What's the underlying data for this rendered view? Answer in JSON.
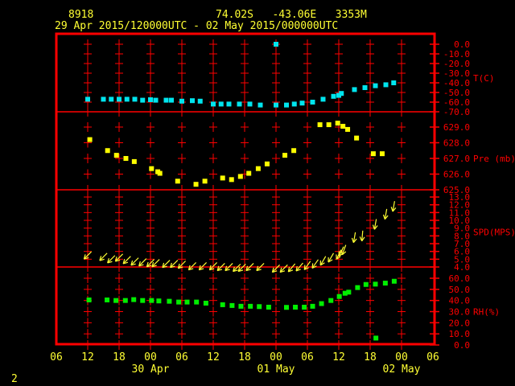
{
  "header": {
    "station_id": "8918",
    "location": "74.02S   -43.06E   3353M",
    "period": "29 Apr 2015/120000UTC - 02 May 2015/000000UTC"
  },
  "footer": {
    "page": "2"
  },
  "colors": {
    "frame": "#ff0000",
    "text": "#ffff33",
    "temperature": "#00e5ee",
    "pressure": "#ffff00",
    "wind": "#ffff33",
    "rh": "#00ee00"
  },
  "chart_data": {
    "type": "scatter",
    "x_unit": "hours after 29 Apr 2015 12 UTC",
    "x_ticks": [
      "06",
      "12",
      "18",
      "00",
      "06",
      "12",
      "18",
      "00",
      "06",
      "12",
      "18",
      "00",
      "06"
    ],
    "x_tick_hours": [
      -6,
      0,
      6,
      12,
      18,
      24,
      30,
      36,
      42,
      48,
      54,
      60,
      66
    ],
    "date_labels": [
      {
        "label": "30 Apr",
        "hour": 12
      },
      {
        "label": "01 May",
        "hour": 36
      },
      {
        "label": "02 May",
        "hour": 60
      }
    ],
    "panels": [
      {
        "key": "t",
        "label": "T(C)",
        "ylim": [
          -70,
          0
        ],
        "ticks": [
          "0.0",
          "-10.0",
          "-20.0",
          "-30.0",
          "-40.0",
          "-50.0",
          "-60.0",
          "-70.0"
        ],
        "tick_values": [
          0,
          -10,
          -20,
          -30,
          -40,
          -50,
          -60,
          -70
        ],
        "x": [
          0,
          3,
          4.5,
          6,
          7.5,
          9,
          10.5,
          12,
          13,
          15,
          16,
          18,
          20,
          21.5,
          24,
          25.5,
          27,
          29,
          31,
          33,
          36,
          38,
          39.5,
          41,
          43,
          45,
          47,
          48,
          48.5,
          51,
          53,
          55,
          57,
          58.5,
          36
        ],
        "y": [
          -57,
          -57,
          -57,
          -57,
          -57,
          -57,
          -58,
          -57.5,
          -58,
          -58,
          -58,
          -59,
          -58.5,
          -59,
          -62,
          -62,
          -62,
          -62,
          -62,
          -63,
          -63,
          -63,
          -62,
          -61,
          -60,
          -57,
          -54,
          -53,
          -51,
          -47,
          -45,
          -43,
          -42,
          -40,
          0
        ]
      },
      {
        "key": "pre",
        "label": "Pre (mb)",
        "ylim": [
          625,
          630
        ],
        "ticks": [
          "629.0",
          "628.0",
          "627.0",
          "626.0",
          "625.0"
        ],
        "tick_values": [
          629,
          628,
          627,
          626,
          625
        ],
        "x": [
          0.4,
          3.8,
          5.5,
          7.3,
          8.9,
          12.2,
          13.4,
          13.8,
          17.2,
          20.7,
          22.4,
          25.8,
          27.5,
          29.2,
          30.8,
          32.6,
          34.3,
          37.7,
          39.4,
          44.4,
          46.1,
          47.8,
          48.8,
          49.7,
          51.4,
          54.6,
          56.3
        ],
        "y": [
          628.2,
          627.5,
          627.2,
          627.0,
          626.8,
          626.35,
          626.15,
          626.05,
          625.55,
          625.35,
          625.55,
          625.75,
          625.65,
          625.85,
          626.05,
          626.35,
          626.65,
          627.2,
          627.5,
          629.15,
          629.15,
          629.25,
          629.05,
          628.85,
          628.3,
          627.3,
          627.3
        ]
      },
      {
        "key": "spd",
        "label": "SPD(MPS)",
        "ylim": [
          4,
          14
        ],
        "ticks": [
          "13.0",
          "12.0",
          "11.0",
          "10.0",
          "9.0",
          "8.0",
          "7.0",
          "6.0",
          "5.0",
          "4.0"
        ],
        "tick_values": [
          13,
          12,
          11,
          10,
          9,
          8,
          7,
          6,
          5,
          4
        ],
        "x": [
          0,
          3,
          4.5,
          6,
          7.5,
          9,
          10.5,
          12,
          13,
          15,
          16.5,
          18,
          20,
          22,
          24,
          25.5,
          27,
          28.5,
          29.5,
          31,
          33,
          36,
          37.5,
          39,
          40.5,
          42,
          43.5,
          45,
          46.5,
          48,
          48.5,
          49,
          51,
          52.5,
          55,
          57,
          58.5
        ],
        "y": [
          5.5,
          5.3,
          5.0,
          5.2,
          4.9,
          4.7,
          4.6,
          4.5,
          4.5,
          4.4,
          4.4,
          4.3,
          4.1,
          4.1,
          4.1,
          4.0,
          4.0,
          3.9,
          3.9,
          4.0,
          4.0,
          3.8,
          3.8,
          3.9,
          4.0,
          4.2,
          4.4,
          4.8,
          5.2,
          5.6,
          6.0,
          6.2,
          7.8,
          8.0,
          9.5,
          10.8,
          11.8
        ],
        "direction_deg": [
          45,
          45,
          45,
          45,
          45,
          45,
          45,
          45,
          45,
          45,
          45,
          45,
          45,
          45,
          45,
          45,
          45,
          45,
          45,
          45,
          45,
          45,
          45,
          40,
          40,
          35,
          35,
          30,
          30,
          25,
          25,
          20,
          10,
          5,
          10,
          10,
          10
        ]
      },
      {
        "key": "rh",
        "label": "RH(%)",
        "ylim": [
          0,
          65
        ],
        "ticks": [
          "60.0",
          "50.0",
          "40.0",
          "30.0",
          "20.0",
          "10.0",
          "0.0"
        ],
        "tick_values": [
          60,
          50,
          40,
          30,
          20,
          10,
          0
        ],
        "x": [
          0.25,
          3.7,
          5.4,
          7.2,
          8.8,
          10.5,
          12.2,
          13.6,
          15.6,
          17.4,
          19,
          20.8,
          22.6,
          25.8,
          27.6,
          29.3,
          31.1,
          32.8,
          34.6,
          38,
          39.7,
          41.4,
          43,
          44.7,
          46.5,
          48.1,
          49.2,
          49.9,
          51.6,
          53.2,
          55,
          56.9,
          58.6,
          55.1
        ],
        "y": [
          40.5,
          40.5,
          40,
          40,
          40.8,
          40,
          40,
          39.6,
          39.3,
          38.6,
          38.6,
          38.6,
          37.6,
          36.2,
          35.5,
          34.8,
          34.8,
          34.5,
          34,
          33.8,
          34,
          34,
          34.8,
          37.2,
          40,
          43.6,
          46.5,
          47.5,
          51.6,
          54.4,
          54.7,
          55.6,
          57.3,
          6.2
        ]
      }
    ]
  }
}
